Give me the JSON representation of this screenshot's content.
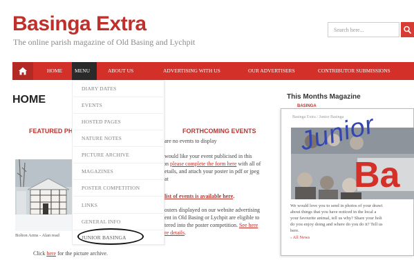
{
  "site": {
    "title": "Basinga Extra",
    "tagline": "The online parish magazine of Old Basing and Lychpit"
  },
  "search": {
    "placeholder": "Search here..."
  },
  "nav": {
    "home_label": "HOME",
    "menu_label": "MENU",
    "about_label": "ABOUT US",
    "advertising_label": "ADVERTISING WITH US",
    "advertisers_label": "OUR ADVERTISERS",
    "contributor_label": "CONTRIBUTOR SUBMISSIONS"
  },
  "dropdown": {
    "items": [
      "DIARY DATES",
      "EVENTS",
      "HOSTED PAGES",
      "NATURE NOTES",
      "PICTURE ARCHIVE",
      "MAGAZINES",
      "POSTER COMPETITION",
      "LINKS",
      "GENERAL INFO",
      "JUNIOR BASINGA"
    ]
  },
  "main": {
    "page_title": "HOME",
    "featured_heading": "FEATURED PHOT",
    "photo_caption": "Bolton Arms - Alan read",
    "picture_link_prefix": "Click ",
    "picture_link": "here",
    "picture_link_suffix": " for the picture archive.",
    "events_heading": "FORTHCOMING EVENTS",
    "no_events": "are no events to display",
    "publicise_line1": "would like your event publicised in this",
    "publicise_prefix": "on ",
    "publicise_link": "please complete the form here",
    "publicise_suffix": " with all of",
    "publicise_line3": "etails, and attach your poster in pdf or jpeg",
    "publicise_line4": "at",
    "events_list_link": "list of events is available here",
    "events_list_suffix": ".",
    "posters_line1": "osters displayed on our website advertising",
    "posters_line2": "ent in Old Basing or Lychpit are eligible to",
    "posters_line3_prefix": "tered into the poster competition. ",
    "posters_see_link": "See here",
    "posters_line4_link": "re details",
    "posters_line4_suffix": "."
  },
  "sidebar": {
    "title": "This Months Magazine",
    "mag_logo": "BASINGA"
  },
  "popup": {
    "breadcrumb": "Basinga Extra / Junior Basinga",
    "image_word1": "Junior",
    "image_word2": "Ba",
    "desc_line1": "We would love you to send in photos of your drawi",
    "desc_line2": "about things that you have noticed in the local a",
    "desc_line3": "your favourite animal, tell us why? Share your holi",
    "desc_line4": "do you enjoy doing and where do you do it? Tell us",
    "desc_line5": "here.",
    "all_news": "All News"
  },
  "colors": {
    "brand_red": "#c0302b",
    "nav_red": "#d3302a",
    "menu_active": "#2a2a2a"
  }
}
